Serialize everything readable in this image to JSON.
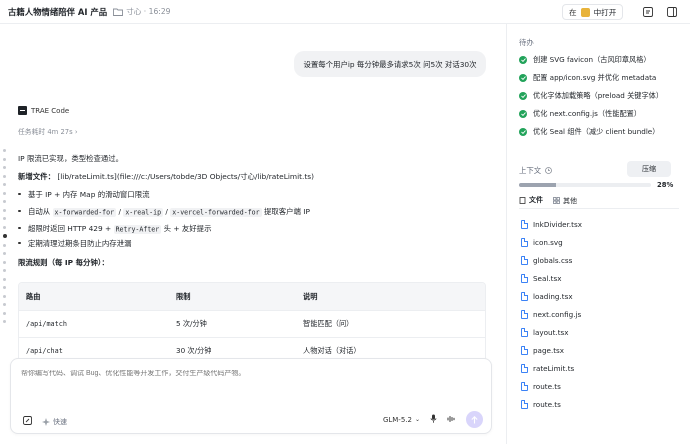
{
  "header": {
    "title": "古籍人物情绪陪伴 AI 产品",
    "meta": "寸心 · 16:29",
    "open_prefix": "在",
    "open_label": "中打开"
  },
  "chat": {
    "user_message": "设置每个用户ip 每分钟最多请求5次 问5次 对话30次",
    "assistant_name": "TRAE Code",
    "elapsed": "任务耗时 4m 27s",
    "intro": "IP 限流已实现，类型检查通过。",
    "new_file_label": "新增文件：",
    "new_file_path": "[lib/rateLimit.ts](file:///c:/Users/tobde/3D Objects/寸心/lib/rateLimit.ts)",
    "bullets": {
      "b1": "基于 IP + 内存 Map 的滑动窗口限流",
      "b2_pre": "自动从",
      "b2_code1": "x-forwarded-for",
      "b2_sep1": "/",
      "b2_code2": "x-real-ip",
      "b2_sep2": "/",
      "b2_code3": "x-vercel-forwarded-for",
      "b2_post": "提取客户端 IP",
      "b3_pre": "超限时返回 HTTP 429 +",
      "b3_code": "Retry-After",
      "b3_post": "头 + 友好提示",
      "b4": "定期清理过期条目防止内存泄漏"
    },
    "rules_heading": "限流规则（每 IP 每分钟）：",
    "table": {
      "headers": [
        "路由",
        "限制",
        "说明"
      ],
      "rows": [
        [
          "/api/match",
          "5 次/分钟",
          "智能匹配（问）"
        ],
        [
          "/api/chat",
          "30 次/分钟",
          "人物对话（对话）"
        ]
      ]
    }
  },
  "input": {
    "placeholder": "帮你编写代码、调试 Bug、优化性能等开发工作，交付生产级代码产物。",
    "speed_label": "快速",
    "model": "GLM-5.2"
  },
  "panel": {
    "todo_title": "待办",
    "todos": [
      "创建 SVG favicon（古风印章风格）",
      "配置 app/icon.svg 并优化 metadata",
      "优化字体加载策略（preload 关键字体）",
      "优化 next.config.js（性能配置）",
      "优化 Seal 组件（减少 client bundle）"
    ],
    "context_title": "上下文",
    "compress_label": "压缩",
    "context_percent": "28%",
    "context_fill": 0.28,
    "tab_files": "文件",
    "tab_other": "其他",
    "files": [
      "InkDivider.tsx",
      "icon.svg",
      "globals.css",
      "Seal.tsx",
      "loading.tsx",
      "next.config.js",
      "layout.tsx",
      "page.tsx",
      "rateLimit.ts",
      "route.ts",
      "route.ts"
    ]
  }
}
